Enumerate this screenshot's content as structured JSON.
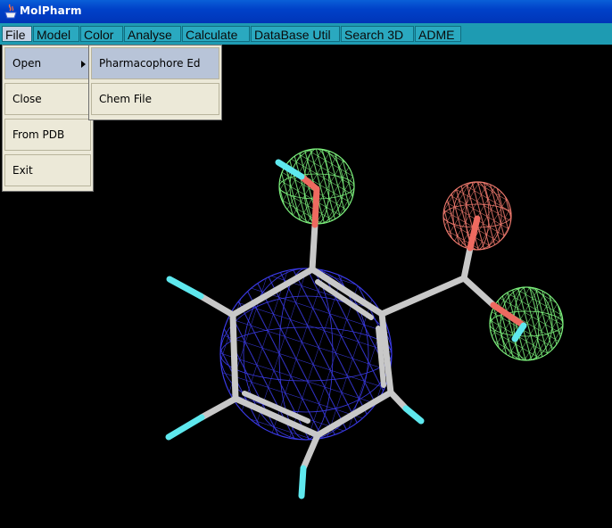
{
  "window": {
    "title": "MolPharm"
  },
  "menubar": {
    "items": [
      "File",
      "Model",
      "Color",
      "Analyse",
      "Calculate",
      "DataBase Util",
      "Search 3D",
      "ADME"
    ]
  },
  "file_menu": {
    "items": [
      "Open",
      "Close",
      "From PDB",
      "Exit"
    ]
  },
  "open_submenu": {
    "items": [
      "Pharmacophore Ed",
      "Chem File"
    ]
  },
  "colors": {
    "menubar": "#1e9bb2",
    "hydrogen": "#5ee8ee",
    "oxygen": "#ee6a60",
    "carbon": "#c8c8c8",
    "donor_sphere": "#7cf07c",
    "acceptor_sphere": "#f07a6e",
    "aromatic_sphere": "#3a3ae6"
  }
}
